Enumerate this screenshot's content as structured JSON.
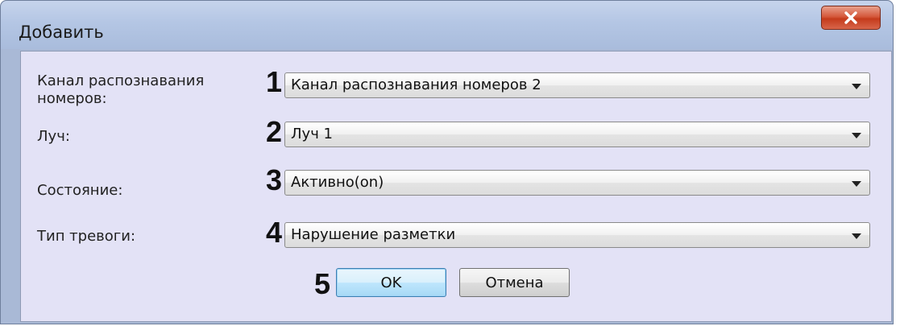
{
  "window": {
    "title": "Добавить"
  },
  "form": {
    "rows": [
      {
        "number": "1",
        "label": "Канал распознавания номеров:",
        "value": "Канал распознавания номеров 2"
      },
      {
        "number": "2",
        "label": "Луч:",
        "value": "Луч 1"
      },
      {
        "number": "3",
        "label": "Состояние:",
        "value": "Активно(on)"
      },
      {
        "number": "4",
        "label": "Тип тревоги:",
        "value": "Нарушение разметки"
      }
    ]
  },
  "buttons": {
    "number": "5",
    "ok_label": "OK",
    "cancel_label": "Отмена"
  },
  "icons": {
    "close": "close-icon",
    "dropdown": "chevron-down-icon"
  },
  "colors": {
    "close_button": "#c43b1c",
    "client_bg": "#e3e2f6",
    "frame": "#a9b9d6"
  }
}
